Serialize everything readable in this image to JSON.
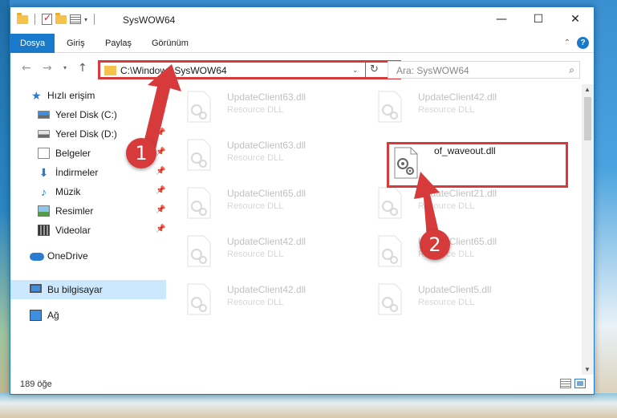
{
  "window": {
    "title": "SysWOW64",
    "controls": {
      "minimize": "—",
      "maximize": "☐",
      "close": "✕"
    }
  },
  "ribbon": {
    "tabs": [
      "Dosya",
      "Giriş",
      "Paylaş",
      "Görünüm"
    ],
    "active_tab": "Dosya",
    "accent_color": "#1979ca",
    "help": "?"
  },
  "navbar": {
    "back": "←",
    "forward": "→",
    "recent": "▾",
    "up": "↑",
    "address": "C:\\Windows\\SysWOW64",
    "address_dropdown": "⌄",
    "refresh": "↻",
    "search_placeholder": "Ara: SysWOW64",
    "search_icon": "⌕"
  },
  "navpane": {
    "items": [
      {
        "label": "Hızlı erişim",
        "icon": "star-icon",
        "pinned": false
      },
      {
        "label": "Yerel Disk (C:)",
        "icon": "drive-icon",
        "pinned": true
      },
      {
        "label": "Yerel Disk (D:)",
        "icon": "drive-icon",
        "pinned": true
      },
      {
        "label": "Belgeler",
        "icon": "documents-icon",
        "pinned": true
      },
      {
        "label": "İndirmeler",
        "icon": "download-icon",
        "pinned": true
      },
      {
        "label": "Müzik",
        "icon": "music-icon",
        "pinned": true
      },
      {
        "label": "Resimler",
        "icon": "pictures-icon",
        "pinned": true
      },
      {
        "label": "Videolar",
        "icon": "videos-icon",
        "pinned": true
      },
      {
        "label": "OneDrive",
        "icon": "cloud-icon",
        "pinned": false
      },
      {
        "label": "Bu bilgisayar",
        "icon": "computer-icon",
        "pinned": false,
        "selected": true
      },
      {
        "label": "Ağ",
        "icon": "network-icon",
        "pinned": false
      }
    ]
  },
  "files": [
    {
      "name": "UpdateClient63.dll",
      "type": "Resource DLL"
    },
    {
      "name": "UpdateClient42.dll",
      "type": "Resource DLL"
    },
    {
      "name": "UpdateClient63.dll",
      "type": "Resource DLL"
    },
    {
      "name": "of_waveout.dll",
      "type": ""
    },
    {
      "name": "UpdateClient65.dll",
      "type": "Resource DLL"
    },
    {
      "name": "UpdateClient21.dll",
      "type": "Resource DLL"
    },
    {
      "name": "UpdateClient42.dll",
      "type": "Resource DLL"
    },
    {
      "name": "UpdateClient65.dll",
      "type": "Resource DLL"
    },
    {
      "name": "UpdateClient42.dll",
      "type": "Resource DLL"
    },
    {
      "name": "UpdateClient5.dll",
      "type": "Resource DLL"
    }
  ],
  "status": {
    "count": "189 öğe"
  },
  "annotations": {
    "step1": "1",
    "step2": "2",
    "color": "#d63a3a"
  }
}
